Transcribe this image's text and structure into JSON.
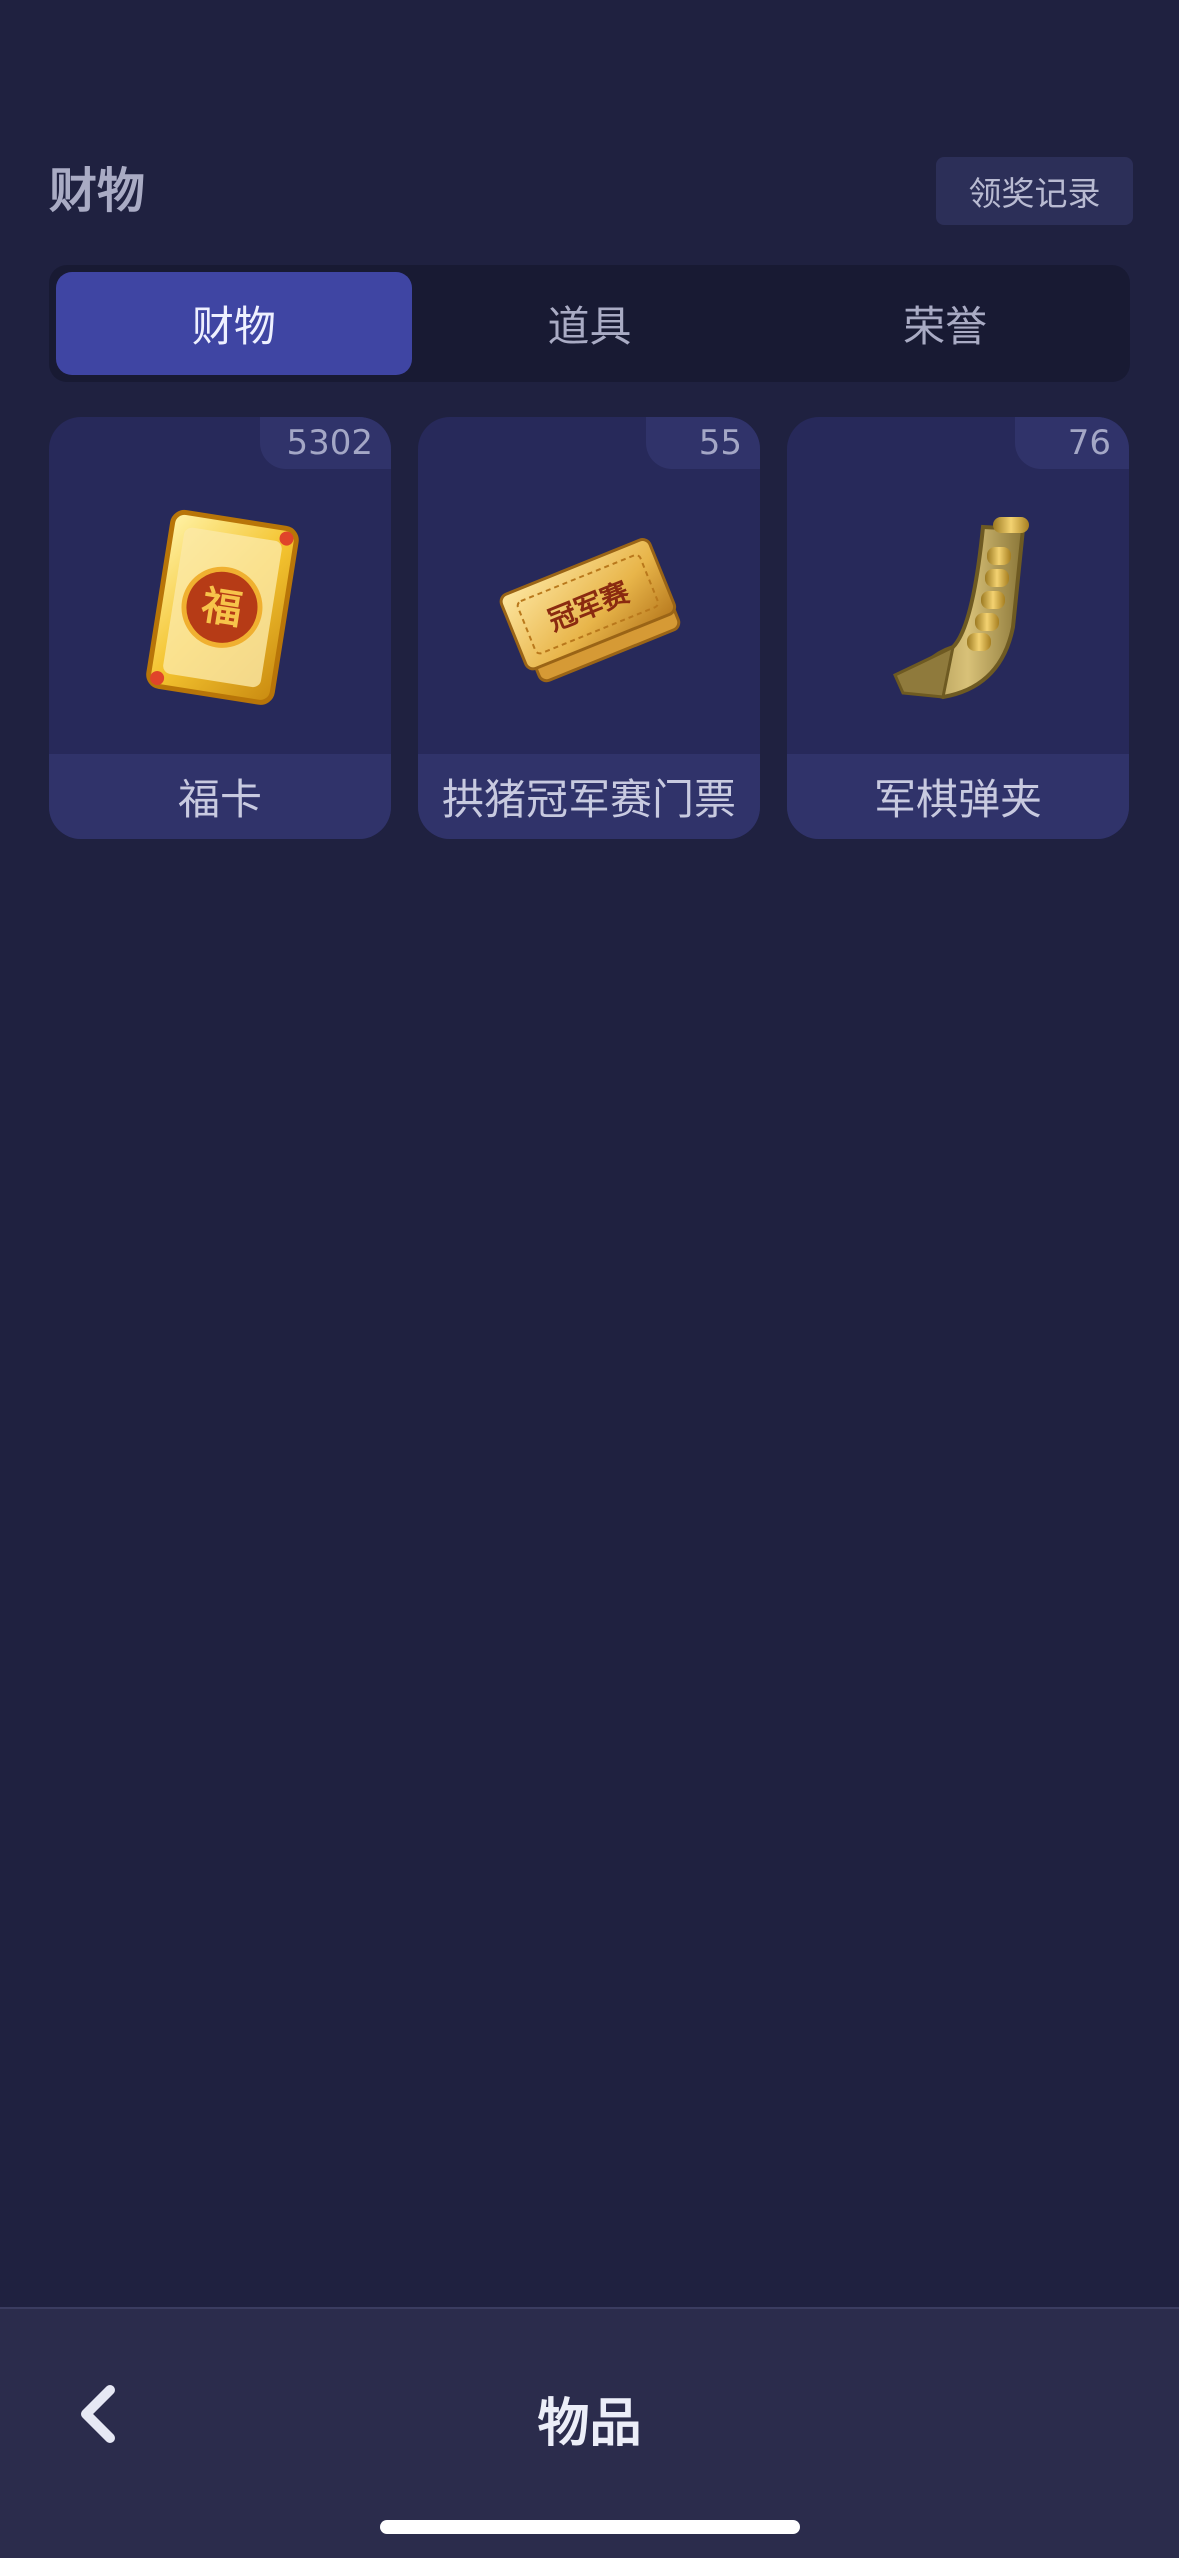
{
  "header": {
    "title": "财物",
    "record_button": "领奖记录"
  },
  "tabs": [
    {
      "label": "财物",
      "active": true
    },
    {
      "label": "道具",
      "active": false
    },
    {
      "label": "荣誉",
      "active": false
    }
  ],
  "items": [
    {
      "name": "福卡",
      "count": "5302",
      "icon": "fortune-card-icon"
    },
    {
      "name": "拱猪冠军赛门票",
      "count": "55",
      "icon": "ticket-icon"
    },
    {
      "name": "军棋弹夹",
      "count": "76",
      "icon": "ammo-clip-icon"
    }
  ],
  "bottom": {
    "title": "物品"
  },
  "colors": {
    "background": "#1f2140",
    "active_tab": "#3f45a3",
    "card": "#27295a",
    "gold": "#f2c230"
  }
}
